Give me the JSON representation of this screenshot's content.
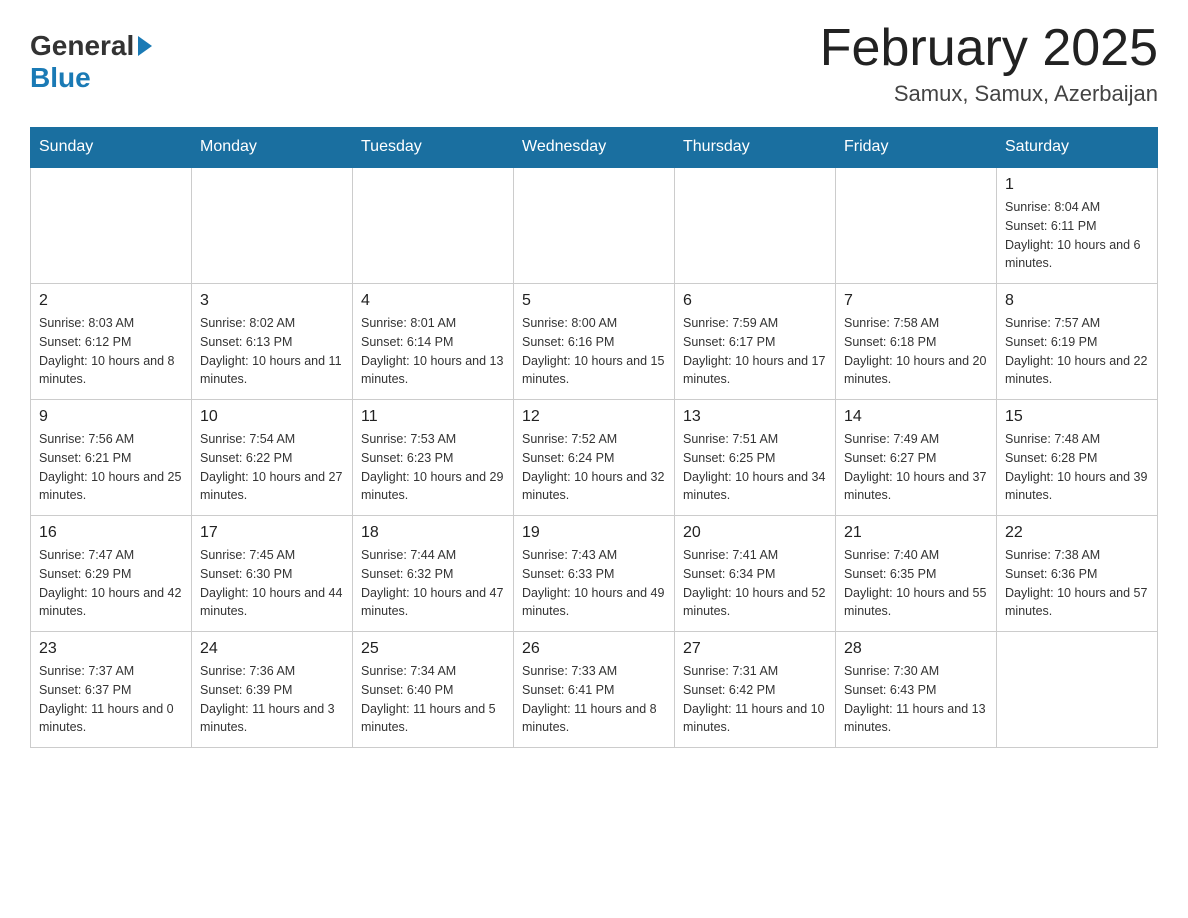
{
  "header": {
    "logo_general": "General",
    "logo_blue": "Blue",
    "title": "February 2025",
    "subtitle": "Samux, Samux, Azerbaijan"
  },
  "weekdays": [
    "Sunday",
    "Monday",
    "Tuesday",
    "Wednesday",
    "Thursday",
    "Friday",
    "Saturday"
  ],
  "weeks": [
    [
      {
        "day": "",
        "info": ""
      },
      {
        "day": "",
        "info": ""
      },
      {
        "day": "",
        "info": ""
      },
      {
        "day": "",
        "info": ""
      },
      {
        "day": "",
        "info": ""
      },
      {
        "day": "",
        "info": ""
      },
      {
        "day": "1",
        "info": "Sunrise: 8:04 AM\nSunset: 6:11 PM\nDaylight: 10 hours and 6 minutes."
      }
    ],
    [
      {
        "day": "2",
        "info": "Sunrise: 8:03 AM\nSunset: 6:12 PM\nDaylight: 10 hours and 8 minutes."
      },
      {
        "day": "3",
        "info": "Sunrise: 8:02 AM\nSunset: 6:13 PM\nDaylight: 10 hours and 11 minutes."
      },
      {
        "day": "4",
        "info": "Sunrise: 8:01 AM\nSunset: 6:14 PM\nDaylight: 10 hours and 13 minutes."
      },
      {
        "day": "5",
        "info": "Sunrise: 8:00 AM\nSunset: 6:16 PM\nDaylight: 10 hours and 15 minutes."
      },
      {
        "day": "6",
        "info": "Sunrise: 7:59 AM\nSunset: 6:17 PM\nDaylight: 10 hours and 17 minutes."
      },
      {
        "day": "7",
        "info": "Sunrise: 7:58 AM\nSunset: 6:18 PM\nDaylight: 10 hours and 20 minutes."
      },
      {
        "day": "8",
        "info": "Sunrise: 7:57 AM\nSunset: 6:19 PM\nDaylight: 10 hours and 22 minutes."
      }
    ],
    [
      {
        "day": "9",
        "info": "Sunrise: 7:56 AM\nSunset: 6:21 PM\nDaylight: 10 hours and 25 minutes."
      },
      {
        "day": "10",
        "info": "Sunrise: 7:54 AM\nSunset: 6:22 PM\nDaylight: 10 hours and 27 minutes."
      },
      {
        "day": "11",
        "info": "Sunrise: 7:53 AM\nSunset: 6:23 PM\nDaylight: 10 hours and 29 minutes."
      },
      {
        "day": "12",
        "info": "Sunrise: 7:52 AM\nSunset: 6:24 PM\nDaylight: 10 hours and 32 minutes."
      },
      {
        "day": "13",
        "info": "Sunrise: 7:51 AM\nSunset: 6:25 PM\nDaylight: 10 hours and 34 minutes."
      },
      {
        "day": "14",
        "info": "Sunrise: 7:49 AM\nSunset: 6:27 PM\nDaylight: 10 hours and 37 minutes."
      },
      {
        "day": "15",
        "info": "Sunrise: 7:48 AM\nSunset: 6:28 PM\nDaylight: 10 hours and 39 minutes."
      }
    ],
    [
      {
        "day": "16",
        "info": "Sunrise: 7:47 AM\nSunset: 6:29 PM\nDaylight: 10 hours and 42 minutes."
      },
      {
        "day": "17",
        "info": "Sunrise: 7:45 AM\nSunset: 6:30 PM\nDaylight: 10 hours and 44 minutes."
      },
      {
        "day": "18",
        "info": "Sunrise: 7:44 AM\nSunset: 6:32 PM\nDaylight: 10 hours and 47 minutes."
      },
      {
        "day": "19",
        "info": "Sunrise: 7:43 AM\nSunset: 6:33 PM\nDaylight: 10 hours and 49 minutes."
      },
      {
        "day": "20",
        "info": "Sunrise: 7:41 AM\nSunset: 6:34 PM\nDaylight: 10 hours and 52 minutes."
      },
      {
        "day": "21",
        "info": "Sunrise: 7:40 AM\nSunset: 6:35 PM\nDaylight: 10 hours and 55 minutes."
      },
      {
        "day": "22",
        "info": "Sunrise: 7:38 AM\nSunset: 6:36 PM\nDaylight: 10 hours and 57 minutes."
      }
    ],
    [
      {
        "day": "23",
        "info": "Sunrise: 7:37 AM\nSunset: 6:37 PM\nDaylight: 11 hours and 0 minutes."
      },
      {
        "day": "24",
        "info": "Sunrise: 7:36 AM\nSunset: 6:39 PM\nDaylight: 11 hours and 3 minutes."
      },
      {
        "day": "25",
        "info": "Sunrise: 7:34 AM\nSunset: 6:40 PM\nDaylight: 11 hours and 5 minutes."
      },
      {
        "day": "26",
        "info": "Sunrise: 7:33 AM\nSunset: 6:41 PM\nDaylight: 11 hours and 8 minutes."
      },
      {
        "day": "27",
        "info": "Sunrise: 7:31 AM\nSunset: 6:42 PM\nDaylight: 11 hours and 10 minutes."
      },
      {
        "day": "28",
        "info": "Sunrise: 7:30 AM\nSunset: 6:43 PM\nDaylight: 11 hours and 13 minutes."
      },
      {
        "day": "",
        "info": ""
      }
    ]
  ]
}
